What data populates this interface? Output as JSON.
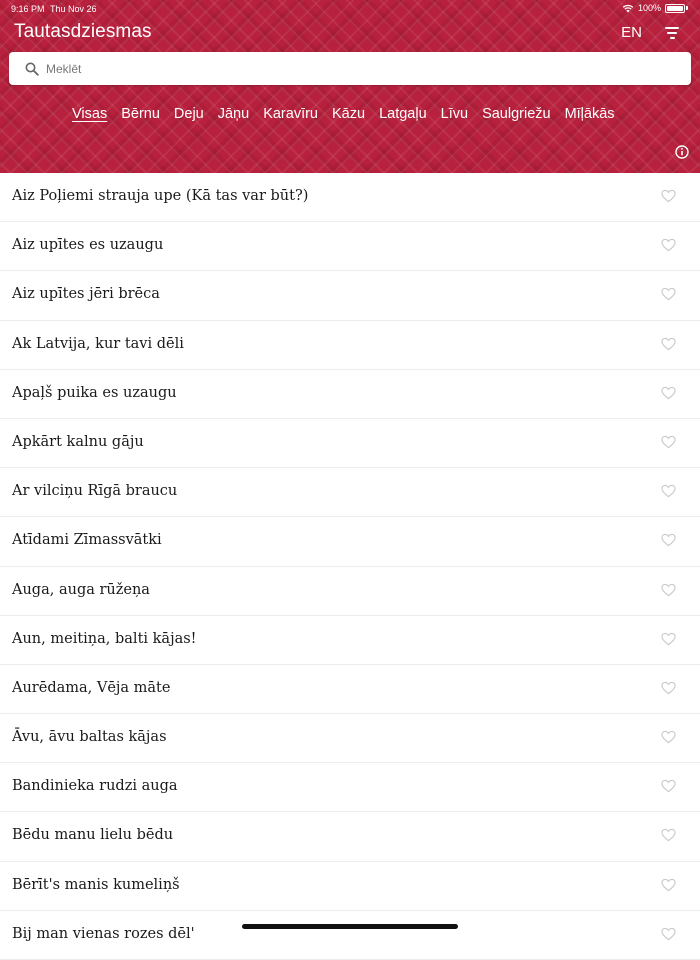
{
  "status_bar": {
    "time": "9:16 PM",
    "date": "Thu Nov 26",
    "battery": "100%"
  },
  "header": {
    "title": "Tautasdziesmas",
    "language": "EN"
  },
  "search": {
    "placeholder": "Meklēt",
    "value": ""
  },
  "tabs": [
    {
      "label": "Visas",
      "active": true
    },
    {
      "label": "Bērnu",
      "active": false
    },
    {
      "label": "Deju",
      "active": false
    },
    {
      "label": "Jāņu",
      "active": false
    },
    {
      "label": "Karavīru",
      "active": false
    },
    {
      "label": "Kāzu",
      "active": false
    },
    {
      "label": "Latgaļu",
      "active": false
    },
    {
      "label": "Līvu",
      "active": false
    },
    {
      "label": "Saulgriežu",
      "active": false
    },
    {
      "label": "Mīļākās",
      "active": false
    }
  ],
  "songs": [
    {
      "title": "Aiz Poļiemi strauja upe (Kā tas var būt?)"
    },
    {
      "title": "Aiz upītes es uzaugu"
    },
    {
      "title": "Aiz upītes jēri brēca"
    },
    {
      "title": "Ak Latvija, kur tavi dēli"
    },
    {
      "title": "Apaļš puika es uzaugu"
    },
    {
      "title": "Apkārt kalnu gāju"
    },
    {
      "title": "Ar vilciņu Rīgā braucu"
    },
    {
      "title": "Atīdami Zīmassvātki"
    },
    {
      "title": "Auga, auga rūžeņa"
    },
    {
      "title": "Aun, meitiņa, balti kājas!"
    },
    {
      "title": "Aurēdama, Vēja māte"
    },
    {
      "title": "Āvu, āvu baltas kājas"
    },
    {
      "title": "Bandinieka rudzi auga"
    },
    {
      "title": "Bēdu manu lielu bēdu"
    },
    {
      "title": "Bērīt's manis kumeliņš"
    },
    {
      "title": "Bij man vienas rozes dēl'"
    }
  ],
  "colors": {
    "header_red": "#b8213d",
    "heart_outline": "#c9c9c9"
  },
  "icons": {
    "search": "search-icon",
    "filter": "filter-icon",
    "info": "info-icon",
    "favorite": "heart-outline-icon"
  }
}
